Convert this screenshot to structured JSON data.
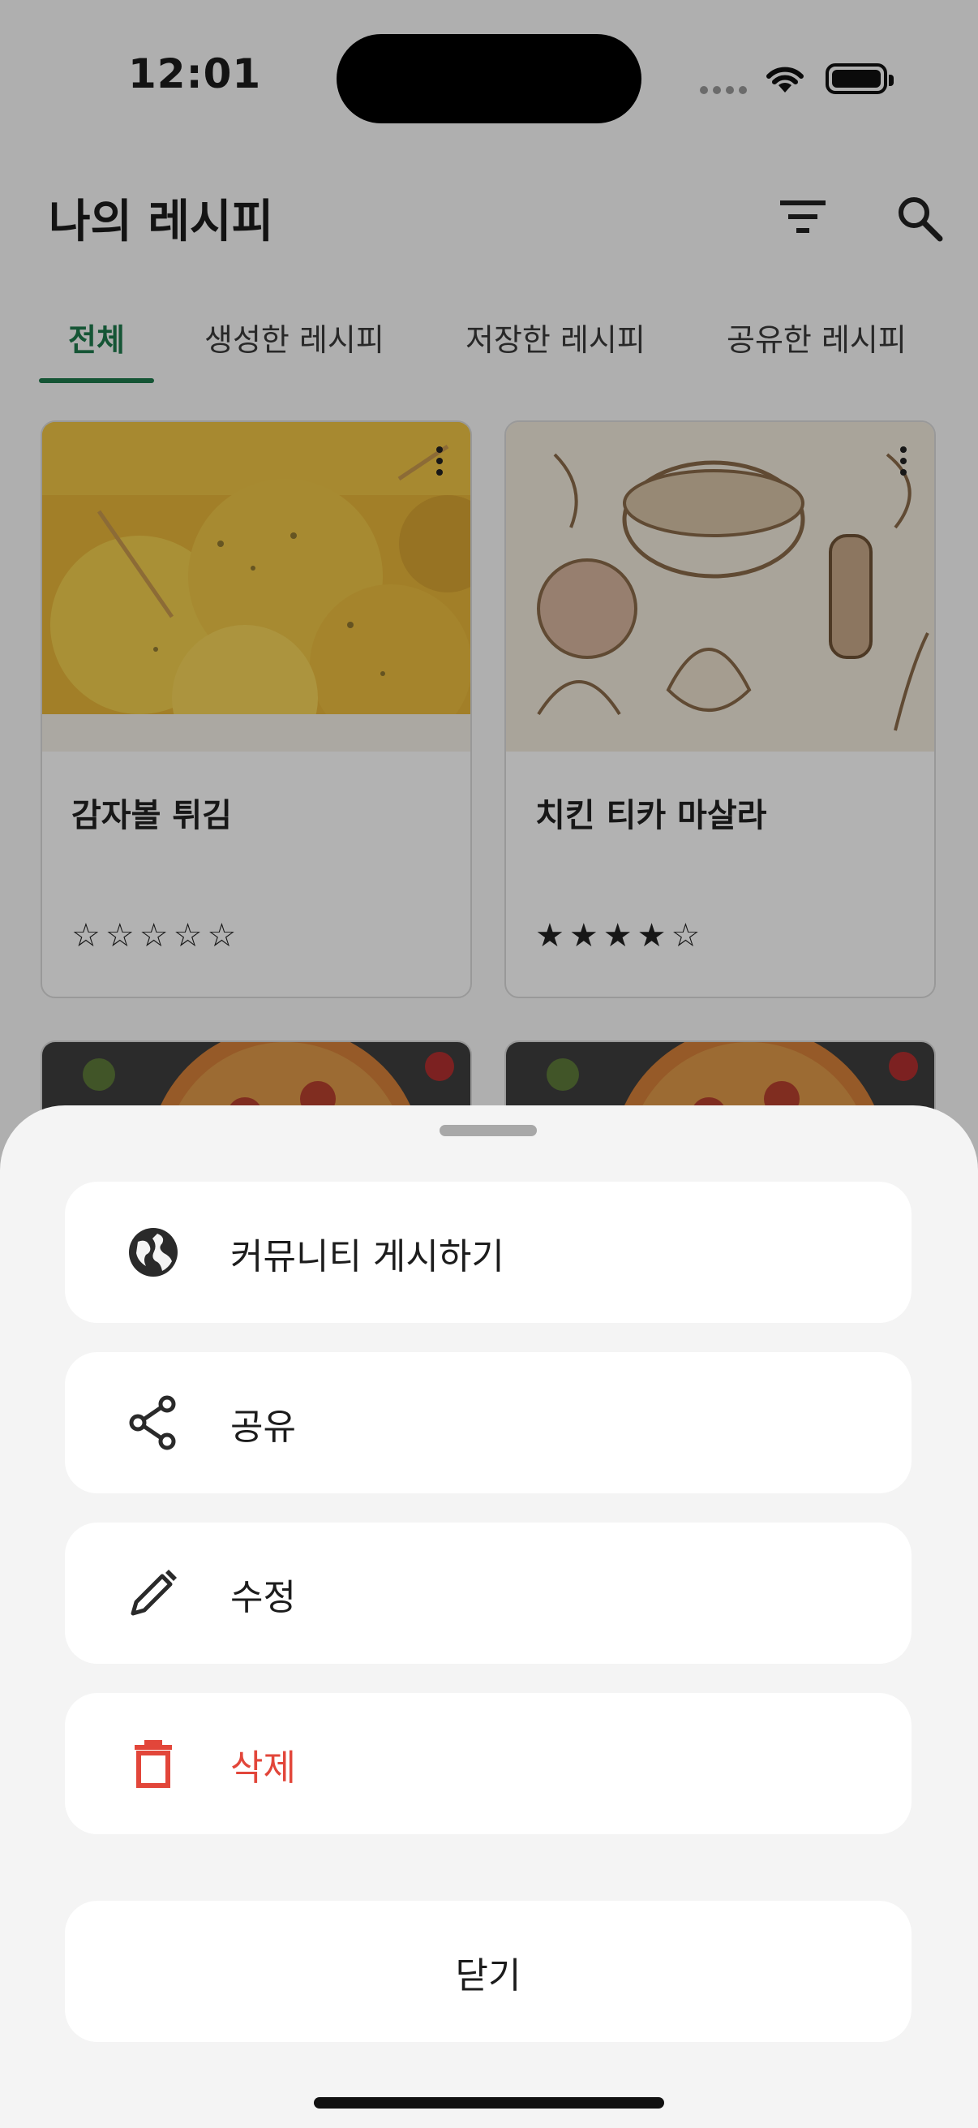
{
  "status": {
    "time": "12:01"
  },
  "header": {
    "title": "나의 레시피"
  },
  "tabs": [
    {
      "label": "전체"
    },
    {
      "label": "생성한 레시피"
    },
    {
      "label": "저장한 레시피"
    },
    {
      "label": "공유한 레시피"
    }
  ],
  "recipes": [
    {
      "title": "감자볼 튀김",
      "rating": 0,
      "stars": "☆☆☆☆☆"
    },
    {
      "title": "치킨 티카 마살라",
      "rating": 4,
      "stars": "★★★★☆"
    }
  ],
  "sheet": {
    "actions": [
      {
        "label": "커뮤니티 게시하기",
        "icon": "globe-icon"
      },
      {
        "label": "공유",
        "icon": "share-icon"
      },
      {
        "label": "수정",
        "icon": "pencil-icon"
      },
      {
        "label": "삭제",
        "icon": "trash-icon",
        "color": "#e2463a"
      }
    ],
    "close_label": "닫기"
  },
  "colors": {
    "accent": "#1f7a4d",
    "danger": "#e2463a"
  }
}
